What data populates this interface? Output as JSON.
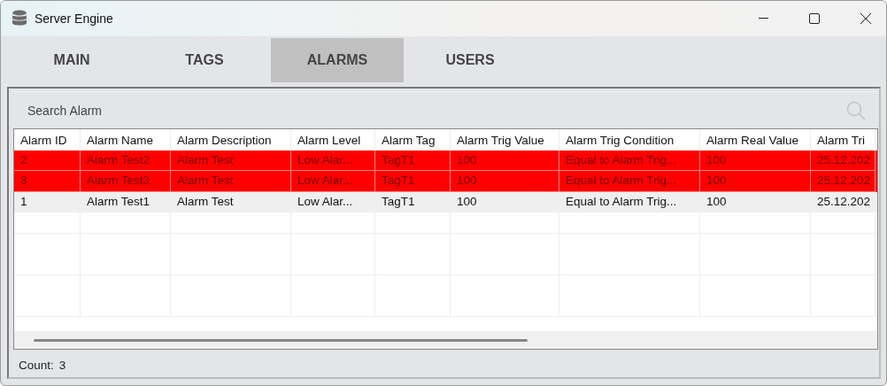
{
  "window": {
    "title": "Server Engine"
  },
  "tabs": [
    {
      "label": "MAIN",
      "selected": false
    },
    {
      "label": "TAGS",
      "selected": false
    },
    {
      "label": "ALARMS",
      "selected": true
    },
    {
      "label": "USERS",
      "selected": false
    }
  ],
  "search": {
    "placeholder": "Search Alarm"
  },
  "table": {
    "columns": [
      "Alarm ID",
      "Alarm Name",
      "Alarm Description",
      "Alarm Level",
      "Alarm Tag",
      "Alarm Trig Value",
      "Alarm Trig Condition",
      "Alarm Real Value",
      "Alarm Tri"
    ],
    "rows": [
      {
        "active": true,
        "cells": [
          "2",
          "Alarm Test2",
          "Alarm Test",
          "Low Alar...",
          "TagT1",
          "100",
          "Equal to Alarm Trig...",
          "100",
          "25.12.202"
        ]
      },
      {
        "active": true,
        "cells": [
          "3",
          "Alarm Test3",
          "Alarm Test",
          "Low Alar...",
          "TagT1",
          "100",
          "Equal to Alarm Trig...",
          "100",
          "25.12.202"
        ]
      },
      {
        "active": false,
        "cells": [
          "1",
          "Alarm Test1",
          "Alarm Test",
          "Low Alar...",
          "TagT1",
          "100",
          "Equal to Alarm Trig...",
          "100",
          "25.12.202"
        ]
      }
    ]
  },
  "status_bar": {
    "label": "Count:",
    "value": "3"
  }
}
